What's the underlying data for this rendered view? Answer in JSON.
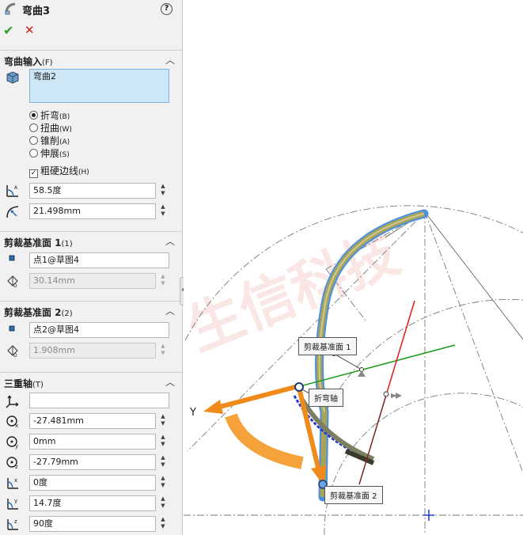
{
  "header": {
    "title": "弯曲3",
    "help": "?"
  },
  "actions": {
    "ok": "✔",
    "cancel": "✕"
  },
  "bend_input": {
    "title": "弯曲输入",
    "shortcut": "(F)",
    "selection": "弯曲2",
    "options": [
      {
        "label": "折弯",
        "key": "(B)",
        "selected": true
      },
      {
        "label": "扭曲",
        "key": "(W)",
        "selected": false
      },
      {
        "label": "锥削",
        "key": "(A)",
        "selected": false
      },
      {
        "label": "伸展",
        "key": "(S)",
        "selected": false
      }
    ],
    "hard_edges": {
      "label": "粗硬边线",
      "key": "(H)",
      "checked": true
    },
    "angle": "58.5度",
    "radius": "21.498mm"
  },
  "trim_plane_1": {
    "title": "剪裁基准面 1",
    "shortcut": "(1)",
    "reference": "点1@草图4",
    "distance": "30.14mm"
  },
  "trim_plane_2": {
    "title": "剪裁基准面 2",
    "shortcut": "(2)",
    "reference": "点2@草图4",
    "distance": "1.908mm"
  },
  "triad": {
    "title": "三重轴",
    "shortcut": "(T)",
    "selection": "",
    "x": "-27.481mm",
    "y": "0mm",
    "z": "-27.79mm",
    "rot_x": "0度",
    "rot_y": "14.7度",
    "rot_z": "90度"
  },
  "viewport": {
    "callout_trim1": "剪裁基准面 1",
    "callout_axis": "折弯轴",
    "callout_trim2": "剪裁基准面 2",
    "axis_label": "Y",
    "watermark": "生信科技"
  },
  "colors": {
    "accent": "#f59a2c",
    "selection": "#cde7f7",
    "axis_green": "#1a9a1a",
    "axis_red": "#e31919",
    "body": "#a7a35b"
  }
}
